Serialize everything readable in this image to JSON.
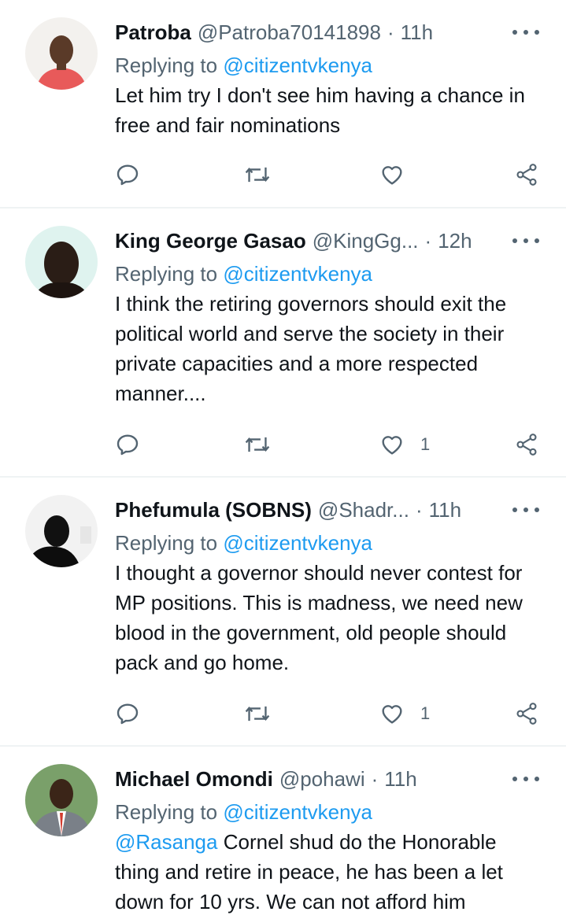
{
  "tweets": [
    {
      "name": "Patroba",
      "handle": "@Patroba70141898",
      "time": "11h",
      "replying_prefix": "Replying to",
      "replying_to": "@citizentvkenya",
      "mention": "",
      "text": "Let him try I don't see him having a chance in free and fair nominations",
      "likes": "",
      "avatar_icon": "person-photo"
    },
    {
      "name": "King George Gasao",
      "handle": "@KingGg...",
      "time": "12h",
      "replying_prefix": "Replying to",
      "replying_to": "@citizentvkenya",
      "mention": "",
      "text": "I think the retiring governors should exit the political world and serve the society in their private capacities and a more respected manner....",
      "likes": "1",
      "avatar_icon": "person-photo"
    },
    {
      "name": "Phefumula (SOBNS)",
      "handle": "@Shadr...",
      "time": "11h",
      "replying_prefix": "Replying to",
      "replying_to": "@citizentvkenya",
      "mention": "",
      "text": "I thought a governor should never contest for MP positions. This is madness, we need new blood in the government, old people should pack and go home.",
      "likes": "1",
      "avatar_icon": "person-photo"
    },
    {
      "name": "Michael Omondi",
      "handle": "@pohawi",
      "time": "11h",
      "replying_prefix": "Replying to",
      "replying_to": "@citizentvkenya",
      "mention": "@Rasanga",
      "text": " Cornel shud do the Honorable thing and retire in peace, he has been a let down for 10 yrs. We can not afford him",
      "likes": "",
      "avatar_icon": "person-photo"
    }
  ],
  "colors": {
    "accent": "#1d9bf0",
    "secondary_text": "#536471",
    "primary_text": "#0f1419",
    "divider": "#eff3f4"
  },
  "icons": {
    "reply": "reply-icon",
    "retweet": "retweet-icon",
    "like": "heart-icon",
    "share": "share-icon",
    "more": "more-icon"
  }
}
